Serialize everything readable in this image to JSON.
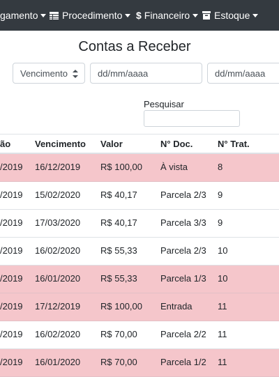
{
  "navbar": {
    "items": [
      {
        "label": "gamento",
        "icon": "none"
      },
      {
        "label": "Procedimento",
        "icon": "table-icon"
      },
      {
        "label": "Financeiro",
        "icon": "dollar-icon"
      },
      {
        "label": "Estoque",
        "icon": "box-icon"
      }
    ],
    "dollar_glyph": "$"
  },
  "page": {
    "title": "Contas a Receber",
    "filter_type": "Vencimento",
    "date_from_placeholder": "dd/mm/aaaa",
    "date_to_placeholder": "dd/mm/aaaa",
    "search_label": "Pesquisar",
    "search_value": ""
  },
  "table": {
    "headers": [
      "ão",
      "Vencimento",
      "Valor",
      "N° Doc.",
      "N° Trat."
    ],
    "rows": [
      {
        "c0": "/2019",
        "vencimento": "16/12/2019",
        "valor": "R$ 100,00",
        "doc": "À vista",
        "trat": "8",
        "status": "pink"
      },
      {
        "c0": "/2019",
        "vencimento": "15/02/2020",
        "valor": "R$ 40,17",
        "doc": "Parcela 2/3",
        "trat": "9",
        "status": "white"
      },
      {
        "c0": "/2019",
        "vencimento": "17/03/2020",
        "valor": "R$ 40,17",
        "doc": "Parcela 3/3",
        "trat": "9",
        "status": "white"
      },
      {
        "c0": "/2019",
        "vencimento": "16/02/2020",
        "valor": "R$ 55,33",
        "doc": "Parcela 2/3",
        "trat": "10",
        "status": "white"
      },
      {
        "c0": "/2019",
        "vencimento": "16/01/2020",
        "valor": "R$ 55,33",
        "doc": "Parcela 1/3",
        "trat": "10",
        "status": "pink"
      },
      {
        "c0": "/2019",
        "vencimento": "17/12/2019",
        "valor": "R$ 100,00",
        "doc": "Entrada",
        "trat": "11",
        "status": "pink"
      },
      {
        "c0": "/2019",
        "vencimento": "16/02/2020",
        "valor": "R$ 70,00",
        "doc": "Parcela 2/2",
        "trat": "11",
        "status": "white"
      },
      {
        "c0": "/2019",
        "vencimento": "16/01/2020",
        "valor": "R$ 70,00",
        "doc": "Parcela 1/2",
        "trat": "11",
        "status": "pink"
      }
    ]
  },
  "colors": {
    "navbar": "#343a40",
    "row_danger": "#f5c6cb",
    "border": "#dee2e6"
  }
}
